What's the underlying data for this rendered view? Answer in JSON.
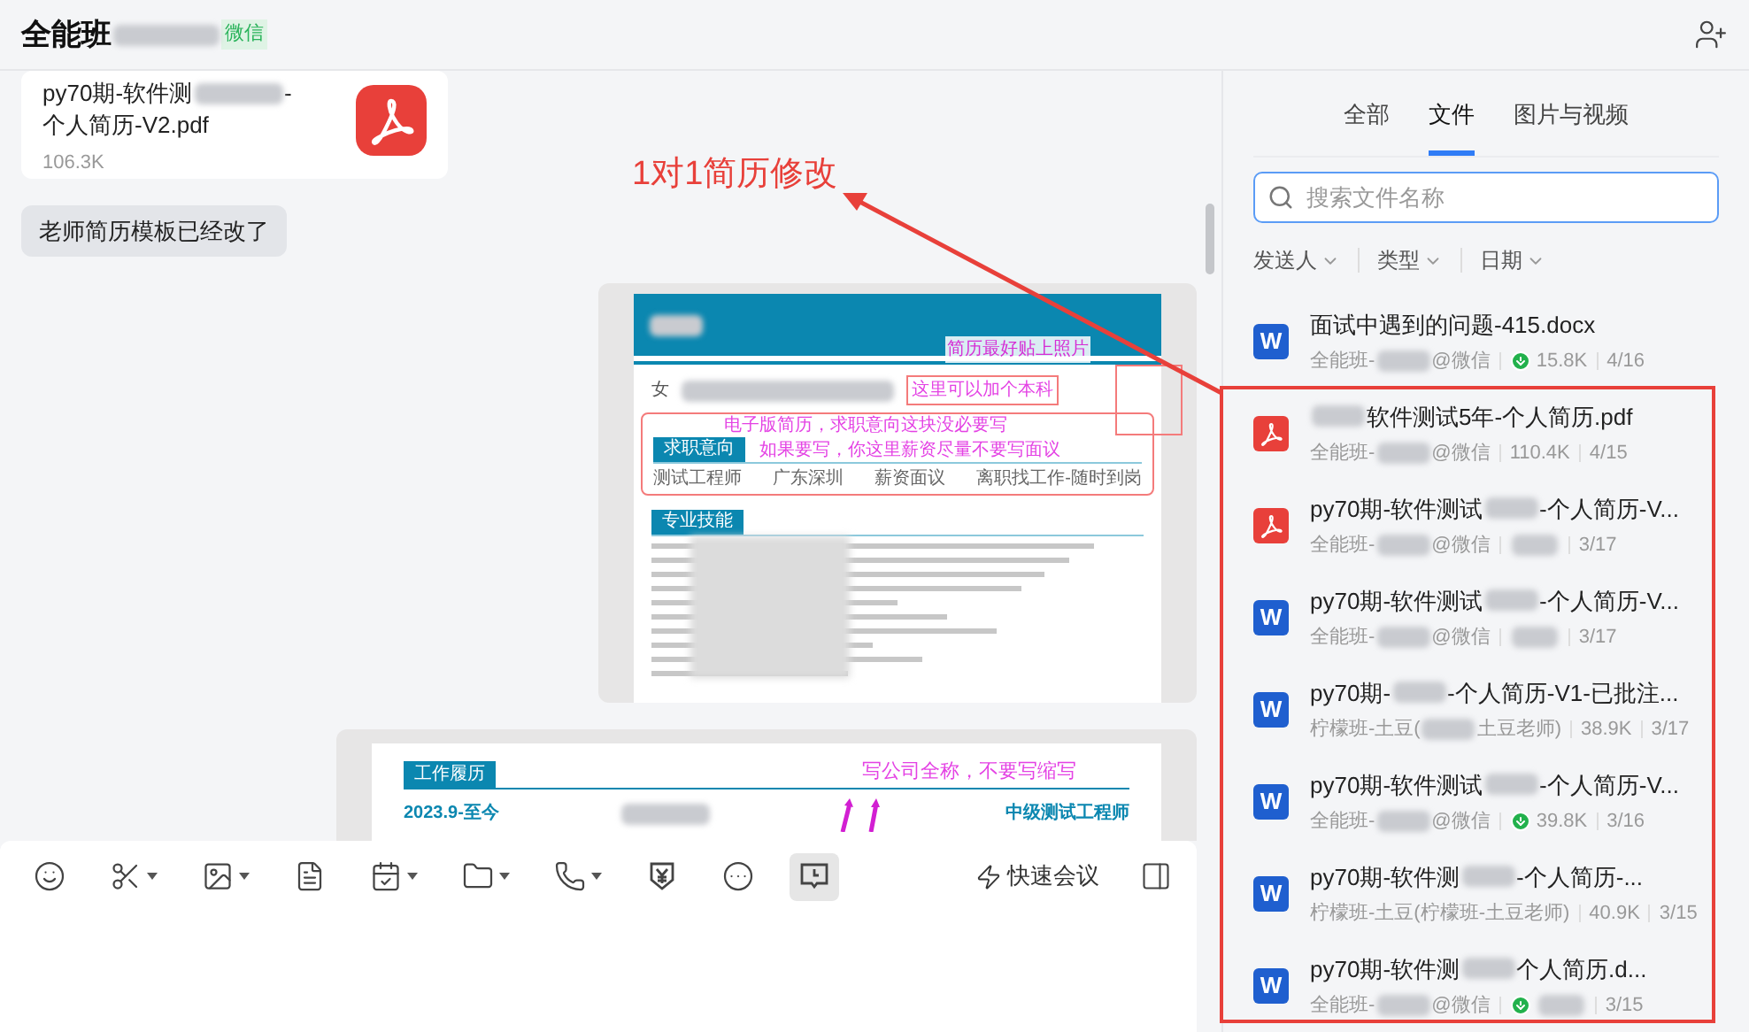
{
  "header": {
    "title": "全能班",
    "tag": "微信"
  },
  "messages": [
    {
      "kind": "pdf_file",
      "line1": [
        {
          "kind": "text",
          "text": "py70期-软件测"
        },
        {
          "kind": "blur"
        },
        {
          "kind": "text",
          "text": "-"
        }
      ],
      "line2": "个人简历-V2.pdf",
      "size": "106.3K"
    },
    {
      "kind": "text",
      "text": "老师简历模板已经改了"
    },
    {
      "kind": "resume_top",
      "photo_note": "简历最好贴上照片",
      "gender": "女",
      "degree_note": "这里可以加个本科",
      "intent_note": "电子版简历，求职意向这块没必要写",
      "intent_heading": "求职意向",
      "salary_note": "如果要写，你这里薪资尽量不要写面议",
      "intent_items": [
        "测试工程师",
        "广东深圳",
        "薪资面议",
        "离职找工作-随时到岗"
      ],
      "skills_heading": "专业技能"
    },
    {
      "kind": "resume_work",
      "heading": "工作履历",
      "note": "写公司全称，不要写缩写",
      "period": "2023.9-至今",
      "role": "中级测试工程师"
    }
  ],
  "annotation": {
    "text": "1对1简历修改"
  },
  "composer": {
    "tools": [
      {
        "kind": "emoji",
        "menu": false,
        "selected": false
      },
      {
        "kind": "scissors",
        "menu": true,
        "selected": false
      },
      {
        "kind": "image",
        "menu": true,
        "selected": false
      },
      {
        "kind": "document",
        "menu": false,
        "selected": false
      },
      {
        "kind": "calendar",
        "menu": true,
        "selected": false
      },
      {
        "kind": "folder",
        "menu": true,
        "selected": false
      },
      {
        "kind": "phone",
        "menu": true,
        "selected": false
      },
      {
        "kind": "yen",
        "menu": false,
        "selected": false
      },
      {
        "kind": "more",
        "menu": false,
        "selected": false
      },
      {
        "kind": "history",
        "menu": false,
        "selected": true
      }
    ],
    "quick_meeting": "快速会议"
  },
  "panel": {
    "tabs": [
      {
        "label": "全部",
        "selected": false
      },
      {
        "label": "文件",
        "selected": true
      },
      {
        "label": "图片与视频",
        "selected": false
      }
    ],
    "search": {
      "placeholder": "搜索文件名称"
    },
    "filters": [
      "发送人",
      "类型",
      "日期"
    ],
    "files": [
      {
        "kind": "word",
        "icon_text": "W",
        "title": [
          {
            "kind": "text",
            "text": "面试中遇到的问题-415.docx"
          }
        ],
        "sender": [
          {
            "kind": "text",
            "text": "全能班-"
          },
          {
            "kind": "blur"
          },
          {
            "kind": "text",
            "text": "@微信"
          }
        ],
        "downloaded": true,
        "size": "15.8K",
        "date": "4/16"
      },
      {
        "kind": "pdf",
        "title": [
          {
            "kind": "blur"
          },
          {
            "kind": "text",
            "text": "软件测试5年-个人简历.pdf"
          }
        ],
        "sender": [
          {
            "kind": "text",
            "text": "全能班-"
          },
          {
            "kind": "blur"
          },
          {
            "kind": "text",
            "text": "@微信"
          }
        ],
        "downloaded": false,
        "size": "110.4K",
        "date": "4/15"
      },
      {
        "kind": "pdf",
        "title": [
          {
            "kind": "text",
            "text": "py70期-软件测试"
          },
          {
            "kind": "blur"
          },
          {
            "kind": "text",
            "text": "-个人简历-V..."
          }
        ],
        "sender": [
          {
            "kind": "text",
            "text": "全能班-"
          },
          {
            "kind": "blur"
          },
          {
            "kind": "text",
            "text": "@微信"
          }
        ],
        "downloaded": false,
        "date": "3/17"
      },
      {
        "kind": "word",
        "icon_text": "W",
        "title": [
          {
            "kind": "text",
            "text": "py70期-软件测试"
          },
          {
            "kind": "blur"
          },
          {
            "kind": "text",
            "text": "-个人简历-V..."
          }
        ],
        "sender": [
          {
            "kind": "text",
            "text": "全能班-"
          },
          {
            "kind": "blur"
          },
          {
            "kind": "text",
            "text": "@微信"
          }
        ],
        "downloaded": false,
        "date": "3/17"
      },
      {
        "kind": "word",
        "icon_text": "W",
        "title": [
          {
            "kind": "text",
            "text": "py70期-"
          },
          {
            "kind": "blur"
          },
          {
            "kind": "text",
            "text": "-个人简历-V1-已批注..."
          }
        ],
        "sender": [
          {
            "kind": "text",
            "text": "柠檬班-土豆("
          },
          {
            "kind": "blur"
          },
          {
            "kind": "text",
            "text": "土豆老师)"
          }
        ],
        "downloaded": false,
        "size": "38.9K",
        "date": "3/17"
      },
      {
        "kind": "word",
        "icon_text": "W",
        "title": [
          {
            "kind": "text",
            "text": "py70期-软件测试"
          },
          {
            "kind": "blur"
          },
          {
            "kind": "text",
            "text": "-个人简历-V..."
          }
        ],
        "sender": [
          {
            "kind": "text",
            "text": "全能班-"
          },
          {
            "kind": "blur"
          },
          {
            "kind": "text",
            "text": "@微信"
          }
        ],
        "downloaded": true,
        "size": "39.8K",
        "date": "3/16"
      },
      {
        "kind": "word",
        "icon_text": "W",
        "title": [
          {
            "kind": "text",
            "text": "py70期-软件测"
          },
          {
            "kind": "blur"
          },
          {
            "kind": "text",
            "text": "-个人简历-..."
          }
        ],
        "sender": [
          {
            "kind": "text",
            "text": "柠檬班-土豆(柠檬班-土豆老师)"
          }
        ],
        "downloaded": false,
        "size": "40.9K",
        "date": "3/15"
      },
      {
        "kind": "word",
        "icon_text": "W",
        "title": [
          {
            "kind": "text",
            "text": "py70期-软件测"
          },
          {
            "kind": "blur"
          },
          {
            "kind": "text",
            "text": "个人简历.d..."
          }
        ],
        "sender": [
          {
            "kind": "text",
            "text": "全能班-"
          },
          {
            "kind": "blur"
          },
          {
            "kind": "text",
            "text": "@微信"
          }
        ],
        "downloaded": true,
        "date": "3/15"
      }
    ]
  }
}
